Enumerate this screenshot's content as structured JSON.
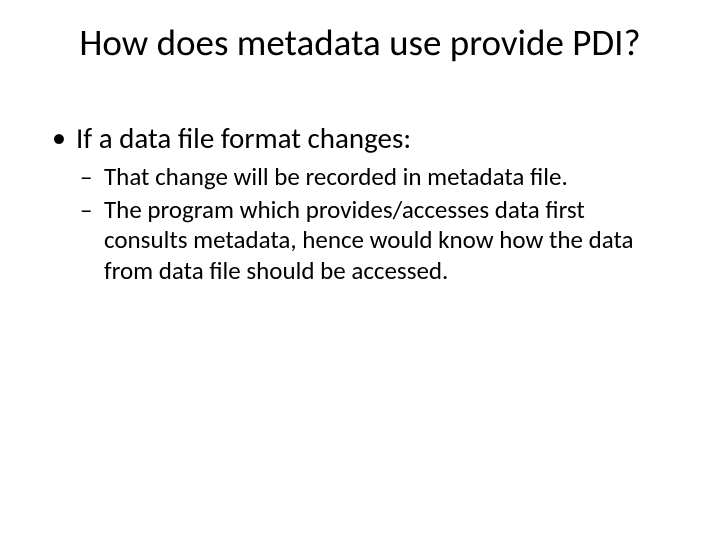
{
  "title": "How does metadata use provide PDI?",
  "bullets": {
    "level1": {
      "item0": "If a data file format changes:"
    },
    "level2": {
      "item0": "That change will be recorded in metadata file.",
      "item1": "The program which provides/accesses data first consults metadata, hence would know how the data from data file should be accessed."
    }
  }
}
